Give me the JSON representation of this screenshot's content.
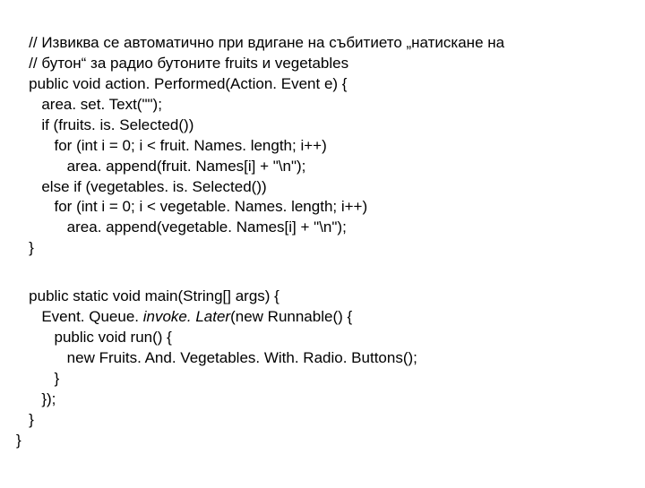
{
  "code": {
    "b1": {
      "l1": "   // Извиква се автоматично при вдигане на събитието „натискане на",
      "l2": "   // бутон“ за радио бутоните fruits и vegetables",
      "l3": "   public void action. Performed(Action. Event e) {",
      "l4": "      area. set. Text(\"\");",
      "l5": "      if (fruits. is. Selected())",
      "l6": "         for (int i = 0; i < fruit. Names. length; i++)",
      "l7": "            area. append(fruit. Names[i] + \"\\n\");",
      "l8": "      else if (vegetables. is. Selected())",
      "l9": "         for (int i = 0; i < vegetable. Names. length; i++)",
      "l10": "            area. append(vegetable. Names[i] + \"\\n\");",
      "l11": "   }"
    },
    "b2": {
      "l1a": "   public static void main(String[] args) {",
      "l2a": "      Event. Queue. ",
      "l2b": "invoke. Later",
      "l2c": "(new Runnable() {",
      "l3a": "         public void run() {",
      "l4a": "            new Fruits. And. Vegetables. With. Radio. Buttons();",
      "l5a": "         }",
      "l6a": "      });",
      "l7a": "   }",
      "l8a": "}"
    }
  }
}
